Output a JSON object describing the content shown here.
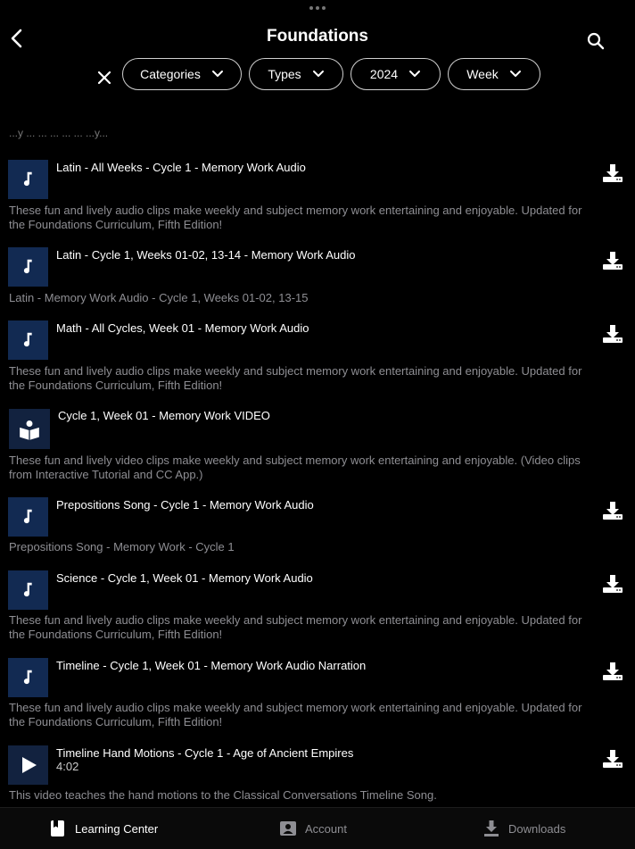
{
  "header": {
    "title": "Foundations"
  },
  "filters": {
    "categories": "Categories",
    "types": "Types",
    "year": "2024",
    "week": "Week"
  },
  "partial_text": "...y ... ... ... ... ... ...y...",
  "items": [
    {
      "title": "Latin - All Weeks - Cycle 1 - Memory Work Audio",
      "type": "audio",
      "desc_line1": "These fun and lively audio clips make weekly and subject memory work entertaining and enjoyable. Updated for",
      "desc_line2": "the Foundations Curriculum, Fifth Edition!"
    },
    {
      "title": "Latin - Cycle 1, Weeks 01-02, 13-14 - Memory Work Audio",
      "type": "audio",
      "desc_line1": "Latin - Memory Work Audio - Cycle 1, Weeks 01-02, 13-15"
    },
    {
      "title": "Math - All Cycles, Week 01 - Memory Work Audio",
      "type": "audio",
      "desc_line1": "These fun and lively audio clips make weekly and subject memory work entertaining and enjoyable. Updated for",
      "desc_line2": "the Foundations Curriculum, Fifth Edition!"
    },
    {
      "title": "Cycle 1, Week 01 - Memory Work VIDEO",
      "type": "reader",
      "desc_line1": "These fun and lively video clips make weekly and subject memory work entertaining and enjoyable. (Video clips",
      "desc_line2": "from Interactive Tutorial and CC App.)"
    },
    {
      "title": "Prepositions Song - Cycle 1 - Memory Work Audio",
      "type": "audio",
      "desc_line1": "Prepositions Song - Memory Work - Cycle 1"
    },
    {
      "title": "Science - Cycle 1, Week 01 - Memory Work Audio",
      "type": "audio",
      "desc_line1": "These fun and lively audio clips make weekly and subject memory work entertaining and enjoyable. Updated for",
      "desc_line2": "the Foundations Curriculum, Fifth Edition!"
    },
    {
      "title": "Timeline - Cycle 1, Week 01 - Memory Work Audio Narration",
      "type": "audio",
      "desc_line1": "These fun and lively audio clips make weekly and subject memory work entertaining and enjoyable. Updated for",
      "desc_line2": "the Foundations Curriculum, Fifth Edition!"
    },
    {
      "title": "Timeline Hand Motions -  Cycle 1 - Age of Ancient Empires",
      "type": "video",
      "duration": "4:02",
      "desc_line1": "This video teaches the hand motions to the Classical Conversations Timeline Song."
    }
  ],
  "tabs": {
    "learning_center": "Learning Center",
    "account": "Account",
    "downloads": "Downloads"
  },
  "colors": {
    "background": "#000000",
    "thumb": "#122a52",
    "muted_text": "#8e8e93"
  }
}
